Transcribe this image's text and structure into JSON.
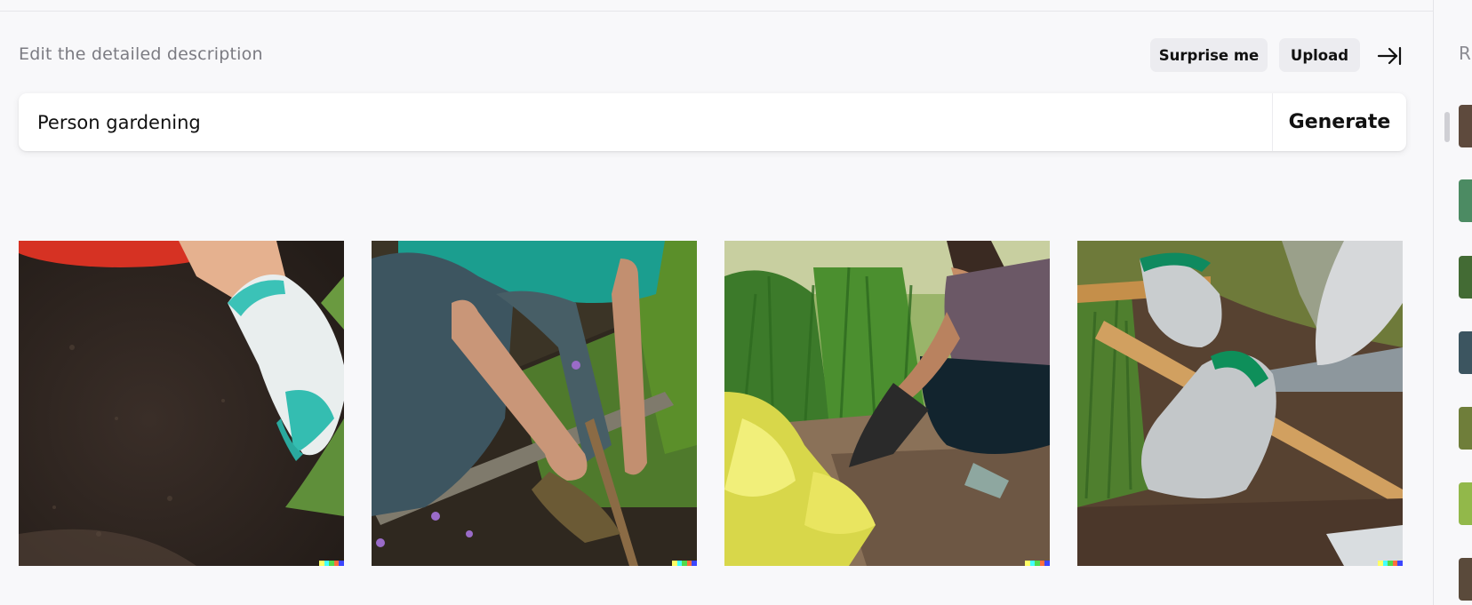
{
  "header": {
    "hint": "Edit the detailed description",
    "surprise_label": "Surprise me",
    "upload_label": "Upload"
  },
  "prompt": {
    "value": "Person gardening",
    "generate_label": "Generate"
  },
  "results": [
    {
      "name": "gardening-result-1",
      "desc": "Gloved hand planting in dark soil"
    },
    {
      "name": "gardening-result-2",
      "desc": "Man in teal shirt pulling weeds from garden bed"
    },
    {
      "name": "gardening-result-3",
      "desc": "Woman crouching among plants in sunny garden"
    },
    {
      "name": "gardening-result-4",
      "desc": "Gloved hands with shovel planting in soil"
    }
  ],
  "sidebar": {
    "title_fragment": "R"
  },
  "colors": {
    "accent_badge": [
      "#ffff66",
      "#42ffff",
      "#51da4c",
      "#ff6e3c",
      "#3c46ff"
    ]
  }
}
